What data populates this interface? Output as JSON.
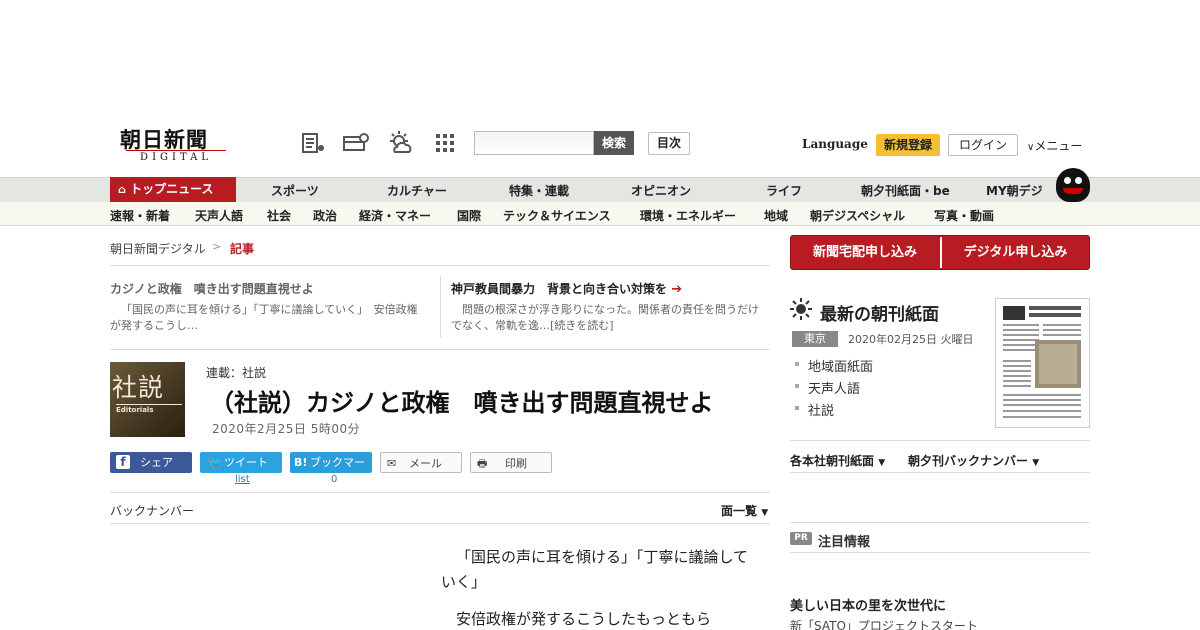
{
  "header": {
    "logo_main": "朝日新聞",
    "logo_sub": "DIGITAL",
    "search_button": "検索",
    "toc_button": "目次",
    "language": "Language",
    "register": "新規登録",
    "login": "ログイン",
    "menu": "メニュー"
  },
  "nav_main": [
    "トップニュース",
    "スポーツ",
    "カルチャー",
    "特集・連載",
    "オピニオン",
    "ライフ",
    "朝夕刊紙面・be",
    "MY朝デジ"
  ],
  "nav_sub": [
    "速報・新着",
    "天声人語",
    "社会",
    "政治",
    "経済・マネー",
    "国際",
    "テック＆サイエンス",
    "環境・エネルギー",
    "地域",
    "朝デジスペシャル",
    "写真・動画"
  ],
  "breadcrumb": {
    "home": "朝日新聞デジタル",
    "sep": ">",
    "current": "記事"
  },
  "related": [
    {
      "title": "カジノと政権　噴き出す問題直視せよ",
      "text": "「国民の声に耳を傾ける」「丁寧に議論していく」　安倍政権が発するこうし…"
    },
    {
      "title": "神戸教員間暴力　背景と向き合い対策を",
      "text": "問題の根深さが浮き彫りになった。関係者の責任を問うだけでなく、常軌を逸…[続きを読む]"
    }
  ],
  "article": {
    "thumb_main": "社説",
    "thumb_sub": "Editorials",
    "series": "連載：社説",
    "title": "（社説）カジノと政権　噴き出す問題直視せよ",
    "date": "2020年2月25日 5時00分",
    "body_1": "「国民の声に耳を傾ける」「丁寧に議論していく」",
    "body_2": "安倍政権が発するこうしたもっともら"
  },
  "share": {
    "facebook": "シェア",
    "twitter": "ツイート",
    "hatena": "ブックマーク",
    "hatena_prefix": "B!",
    "mail": "メール",
    "print": "印刷",
    "twitter_count": "list",
    "hatena_count": "0"
  },
  "backnumber": {
    "label": "バックナンバー",
    "list": "面一覧"
  },
  "sidebar": {
    "subscribe_paper": "新聞宅配申し込み",
    "subscribe_digital": "デジタル申し込み",
    "paper_title": "最新の朝刊紙面",
    "region": "東京",
    "paper_date": "2020年02月25日 火曜日",
    "links": [
      "地域面紙面",
      "天声人語",
      "社説"
    ],
    "drop_1": "各本社朝刊紙面",
    "drop_2": "朝夕刊バックナンバー",
    "pr_badge": "PR",
    "pr_title": "注目情報",
    "ad_title": "美しい日本の里を次世代に",
    "ad_text": "新「SATO」プロジェクトスタート"
  }
}
